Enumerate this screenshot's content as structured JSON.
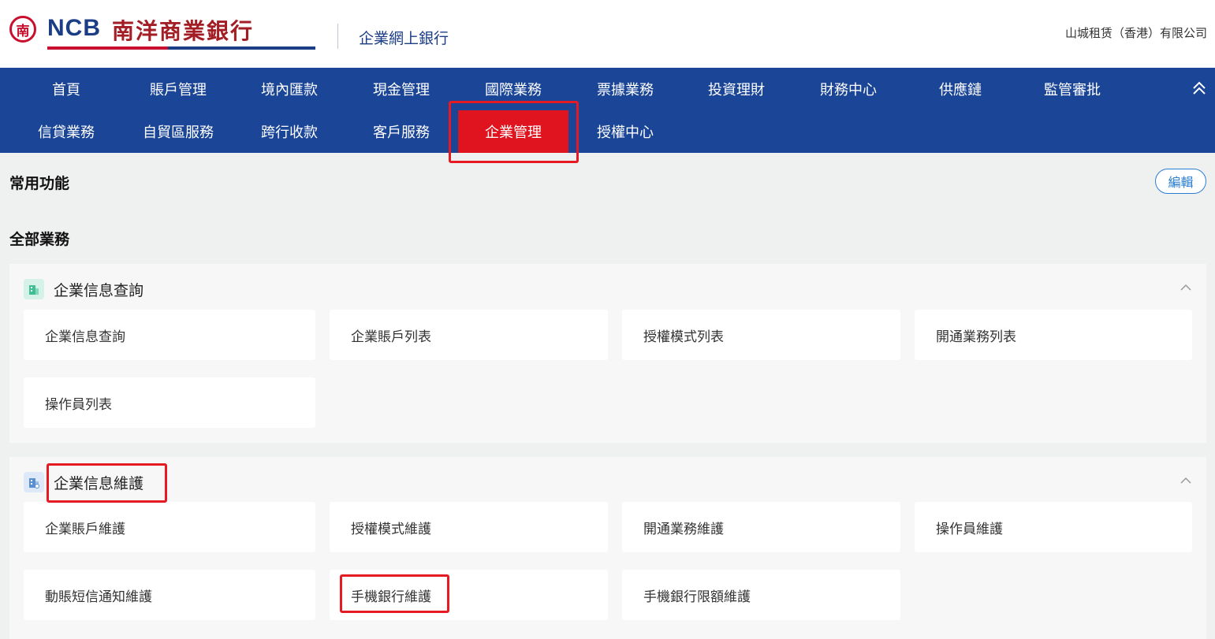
{
  "header": {
    "logo_mark": "南",
    "logo_ncb": "NCB",
    "logo_cn": "南洋商業銀行",
    "subtitle": "企業網上銀行",
    "company": "山城租赁（香港）有限公司"
  },
  "nav": {
    "row1": [
      "首頁",
      "賬戶管理",
      "境內匯款",
      "現金管理",
      "國際業務",
      "票據業務",
      "投資理財",
      "財務中心",
      "供應鏈",
      "監管審批"
    ],
    "row2": [
      "信貸業務",
      "自貿區服務",
      "跨行收款",
      "客戶服務",
      "企業管理",
      "授權中心"
    ],
    "active": "企業管理",
    "collapse_icon": "double-chevron-up-icon"
  },
  "favorites": {
    "title": "常用功能",
    "edit_label": "編輯"
  },
  "all_business": {
    "title": "全部業務"
  },
  "groups": [
    {
      "title": "企業信息查詢",
      "icon": "building-icon",
      "items": [
        "企業信息查詢",
        "企業賬戶列表",
        "授權模式列表",
        "開通業務列表",
        "操作員列表"
      ]
    },
    {
      "title": "企業信息維護",
      "icon": "building-edit-icon",
      "items": [
        "企業賬戶維護",
        "授權模式維護",
        "開通業務維護",
        "操作員維護",
        "動賬短信通知維護",
        "手機銀行維護",
        "手機銀行限額維護"
      ]
    }
  ],
  "colors": {
    "nav_bg": "#1b4597",
    "nav_active": "#e0141f",
    "highlight": "#e51a22",
    "brand_blue": "#1b3d85",
    "brand_red": "#c8102e"
  }
}
